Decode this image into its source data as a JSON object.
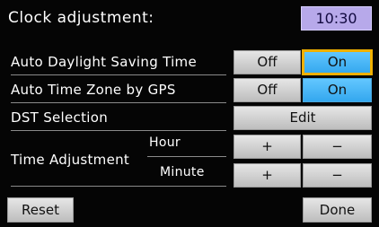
{
  "header": {
    "title": "Clock adjustment:",
    "time": "10:30"
  },
  "rows": {
    "auto_dst": {
      "label": "Auto Daylight Saving Time",
      "off_label": "Off",
      "on_label": "On"
    },
    "auto_tz": {
      "label": "Auto Time Zone by GPS",
      "off_label": "Off",
      "on_label": "On"
    },
    "dst_selection": {
      "label": "DST Selection",
      "edit_label": "Edit"
    },
    "time_adjustment": {
      "label": "Time Adjustment",
      "hour_label": "Hour",
      "minute_label": "Minute",
      "plus_label": "+",
      "minus_label": "−"
    }
  },
  "footer": {
    "reset_label": "Reset",
    "done_label": "Done"
  },
  "colors": {
    "selected": "#33a7ee",
    "focus": "#f0b000",
    "clock_bg": "#b7a9ea"
  }
}
